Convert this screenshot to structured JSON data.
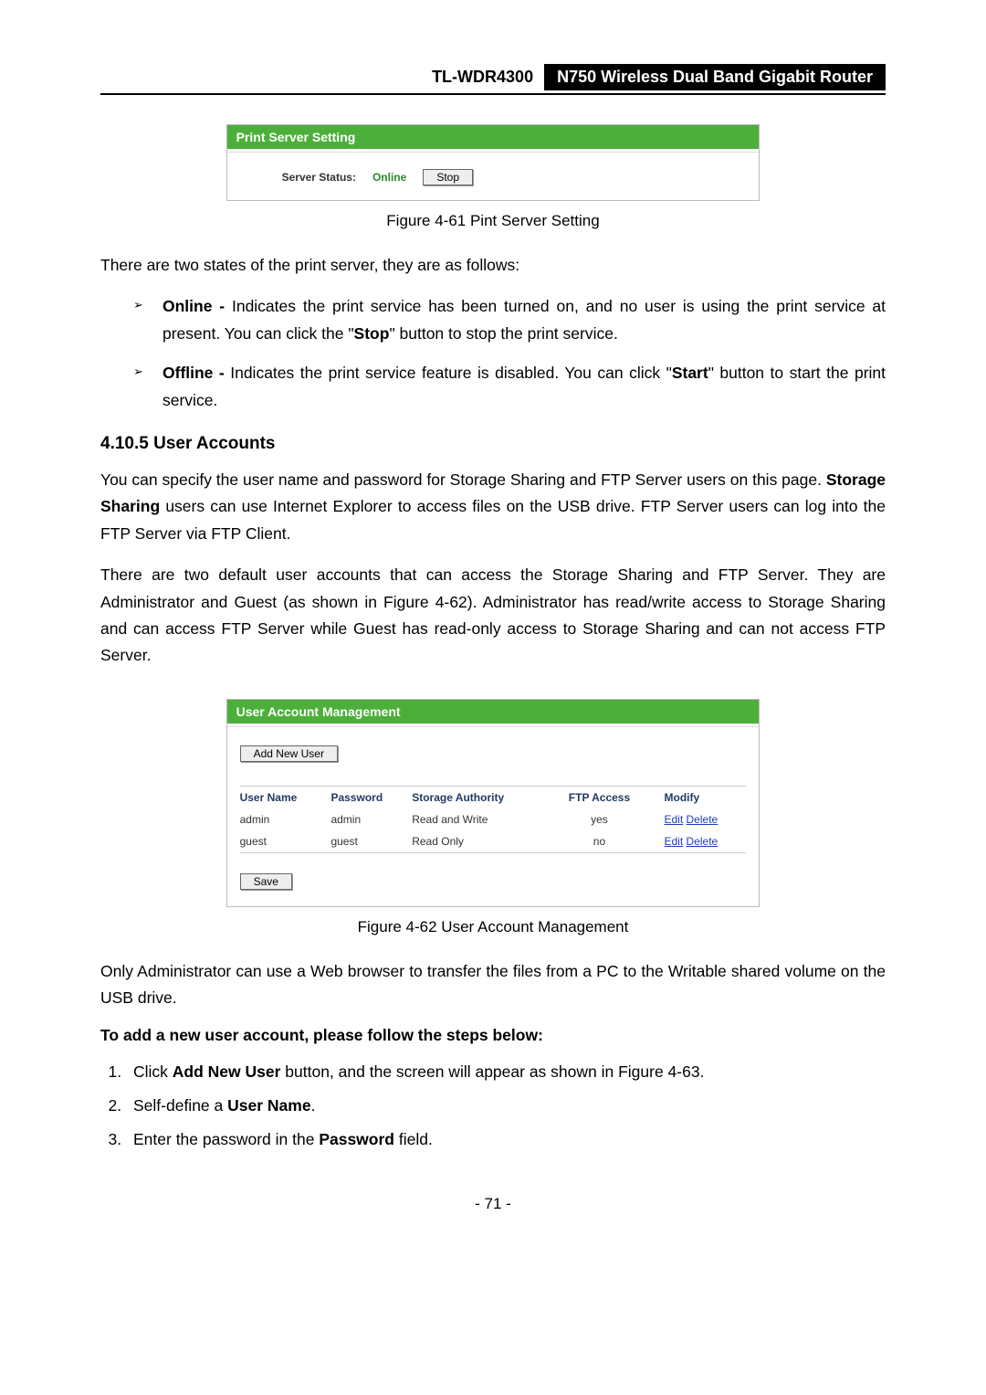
{
  "header": {
    "model": "TL-WDR4300",
    "product": "N750 Wireless Dual Band Gigabit Router"
  },
  "fig1": {
    "title": "Print Server Setting",
    "server_status_label": "Server Status:",
    "server_status_value": "Online",
    "stop_button": "Stop",
    "caption": "Figure 4-61 Pint Server Setting"
  },
  "intro_states": "There are two states of the print server, they are as follows:",
  "state_online_prefix": "Online - ",
  "state_online_body_a": "Indicates the print service has been turned on, and no user is using the print service at present. You can click the \"",
  "state_online_bold": "Stop",
  "state_online_body_b": "\" button to stop the print service.",
  "state_offline_prefix": "Offline - ",
  "state_offline_body_a": "Indicates the print service feature is disabled. You can click \"",
  "state_offline_bold": "Start",
  "state_offline_body_b": "\" button to start the print service.",
  "section_heading": "4.10.5  User Accounts",
  "ua_para1_a": "You can specify the user name and password for Storage Sharing and FTP Server users on this page. ",
  "ua_para1_bold": "Storage Sharing",
  "ua_para1_b": " users can use Internet Explorer to access files on the USB drive. FTP Server users can log into the FTP Server via FTP Client.",
  "ua_para2": "There are two default user accounts that can access the Storage Sharing and FTP Server. They are Administrator and Guest (as shown in Figure 4-62). Administrator has read/write access to Storage Sharing and can access FTP Server while Guest has read-only access to Storage Sharing and can not access FTP Server.",
  "fig2": {
    "title": "User Account Management",
    "add_user_btn": "Add New User",
    "cols": {
      "c1": "User Name",
      "c2": "Password",
      "c3": "Storage Authority",
      "c4": "FTP Access",
      "c5": "Modify"
    },
    "rows": [
      {
        "user": "admin",
        "pass": "admin",
        "auth": "Read and Write",
        "ftp": "yes",
        "edit": "Edit",
        "delete": "Delete"
      },
      {
        "user": "guest",
        "pass": "guest",
        "auth": "Read Only",
        "ftp": "no",
        "edit": "Edit",
        "delete": "Delete"
      }
    ],
    "save_btn": "Save",
    "caption": "Figure 4-62 User Account Management"
  },
  "after_fig2": "Only Administrator can use a Web browser to transfer the files from a PC to the Writable shared volume on the USB drive.",
  "steps_heading": "To add a new user account, please follow the steps below:",
  "step1_a": "Click ",
  "step1_bold": "Add New User",
  "step1_b": " button, and the screen will appear as shown in Figure 4-63.",
  "step2_a": "Self-define a ",
  "step2_bold": "User Name",
  "step2_b": ".",
  "step3_a": "Enter the password in the ",
  "step3_bold": "Password",
  "step3_b": " field.",
  "page_number": "- 71 -"
}
